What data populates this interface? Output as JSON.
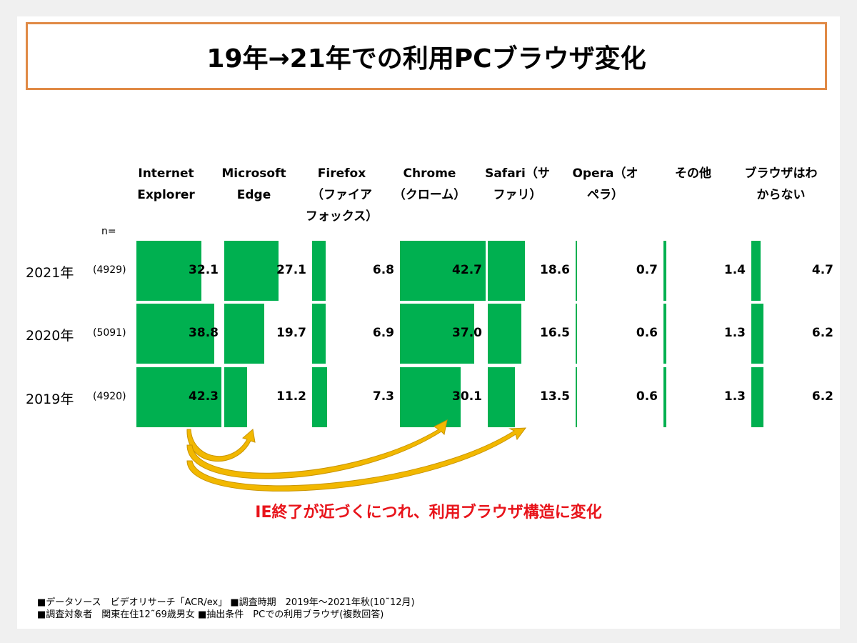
{
  "title": "19年→21年での利用PCブラウザ変化",
  "colors": {
    "bar": "#00b050",
    "title_border": "#e08a46",
    "arrow": "#f2b800",
    "caption": "#e8141b"
  },
  "n_label": "n=",
  "caption": "IE終了が近づくにつれ、利用ブラウザ構造に変化",
  "footer": {
    "line1": "■データソース　ビデオリサーチ「ACR/ex」 ■調査時期　2019年～2021年秋(10˜12月)",
    "line2": "■調査対象者　関東在住12˜69歳男女 ■抽出条件　PCでの利用ブラウザ(複数回答)"
  },
  "chart_data": {
    "type": "bar",
    "orientation": "horizontal-small-multiples",
    "title": "19年→21年での利用PCブラウザ変化",
    "unit": "%",
    "categories": [
      "Internet\nExplorer",
      "Microsoft\nEdge",
      "Firefox\n（ファイア\nフォックス）",
      "Chrome\n（クローム）",
      "Safari（サ\nファリ）",
      "Opera（オ\nペラ）",
      "その他",
      "ブラウザはわ\nからない"
    ],
    "rows": [
      {
        "label": "2021年",
        "n": "(4929)",
        "values": [
          32.1,
          27.1,
          6.8,
          42.7,
          18.6,
          0.7,
          1.4,
          4.7
        ]
      },
      {
        "label": "2020年",
        "n": "(5091)",
        "values": [
          38.8,
          19.7,
          6.9,
          37.0,
          16.5,
          0.6,
          1.3,
          6.2
        ]
      },
      {
        "label": "2019年",
        "n": "(4920)",
        "values": [
          42.3,
          11.2,
          7.3,
          30.1,
          13.5,
          0.6,
          1.3,
          6.2
        ]
      }
    ],
    "value_format": "0.0",
    "annotations": [
      {
        "type": "arrow",
        "from": "Internet Explorer",
        "to": "Microsoft Edge"
      },
      {
        "type": "arrow",
        "from": "Internet Explorer",
        "to": "Chrome"
      },
      {
        "type": "arrow",
        "from": "Internet Explorer",
        "to": "Safari"
      }
    ],
    "legend": "none",
    "grid": false
  }
}
